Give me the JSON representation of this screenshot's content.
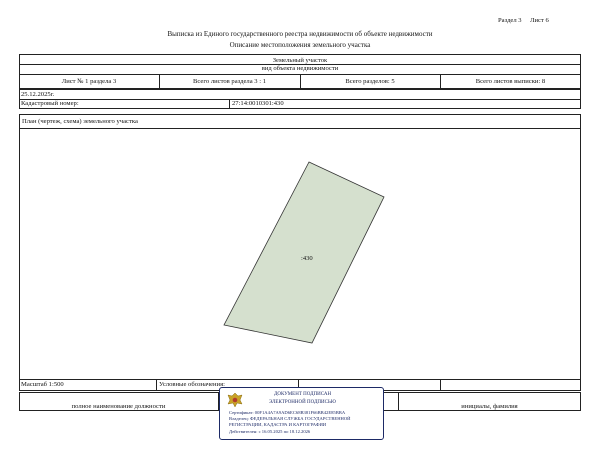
{
  "section": "Раздел 3",
  "sheet": "Лист 6",
  "title": "Выписка из Единого государственного реестра недвижимости об объекте недвижимости",
  "subtitle": "Описание местоположения земельного участка",
  "object_type": "Земельный участок",
  "object_type_caption": "вид объекта недвижимости",
  "sheet_row": {
    "sheet_num": "Лист № 1 раздела 3",
    "total_section": "Всего листов раздела 3 : 1",
    "total_sections": "Всего разделов: 5",
    "total_extract": "Всего листов выписки: 8"
  },
  "date": "25.12.2025г.",
  "cadastral_label": "Кадастровый номер:",
  "cadastral_number": "27:14:0010301:430",
  "plan_label": "План (чертеж, схема) земельного участка",
  "parcel_label": ":430",
  "scale_label": "Масштаб 1:500",
  "legend_label": "Условные обозначения:",
  "footer": {
    "position": "полное наименование должности",
    "initials": "инициалы, фамилия"
  },
  "stamp": {
    "line1": "ДОКУМЕНТ ПОДПИСАН",
    "line2": "ЭЛЕКТРОННОЙ ПОДПИСЬЮ",
    "cert": "Сертификат: 00F1A4A7A9AD6EC68B381F66BB42E85BBA",
    "owner": "Владелец: ФЕДЕРАЛЬНАЯ СЛУЖБА ГОСУДАРСТВЕННОЙ",
    "owner2": "РЕГИСТРАЦИИ, КАДАСТРА И КАРТОГРАФИИ",
    "valid": "Действителен: с 16.05.2025 по 18.12.2026"
  },
  "colors": {
    "parcel_fill": "#d5e0ce",
    "stamp_border": "#1d2a66"
  }
}
